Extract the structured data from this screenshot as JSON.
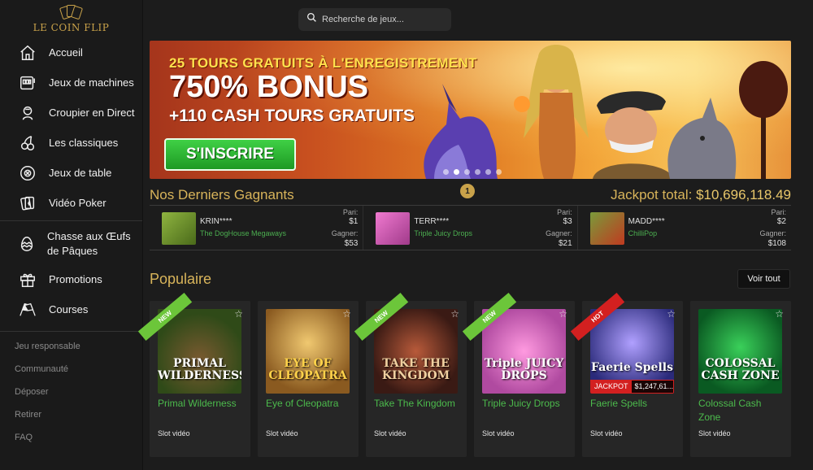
{
  "brand": {
    "name": "LE COIN FLIP"
  },
  "sidebar": {
    "items": [
      {
        "label": "Accueil",
        "icon": "home-icon"
      },
      {
        "label": "Jeux de machines",
        "icon": "slot-machine-icon"
      },
      {
        "label": "Croupier en Direct",
        "icon": "dealer-icon"
      },
      {
        "label": "Les classiques",
        "icon": "cherries-icon"
      },
      {
        "label": "Jeux de table",
        "icon": "chip-icon"
      },
      {
        "label": "Vidéo Poker",
        "icon": "cards-icon"
      },
      {
        "label": "Chasse aux Œufs de Pâques",
        "icon": "egg-icon"
      },
      {
        "label": "Promotions",
        "icon": "gift-icon"
      },
      {
        "label": "Courses",
        "icon": "checkered-flags-icon"
      }
    ],
    "links": [
      "Jeu responsable",
      "Communauté",
      "Déposer",
      "Retirer",
      "FAQ"
    ]
  },
  "search": {
    "placeholder": "Recherche de jeux..."
  },
  "banner": {
    "line1": "25 TOURS GRATUITS À L'ENREGISTREMENT",
    "line2": "750% BONUS",
    "line3": "+110 CASH TOURS GRATUITS",
    "cta": "S'INSCRIRE",
    "dots_count": 6,
    "active_dot": 1
  },
  "winners": {
    "title": "Nos Derniers Gagnants",
    "jackpot_label": "Jackpot total:",
    "jackpot_value": "$10,696,118.49",
    "bet_label": "Pari:",
    "win_label": "Gagner:",
    "entries": [
      {
        "name": "KRIN****",
        "game": "The DogHouse Megaways",
        "bet": "$1",
        "win": "$53",
        "thumb_color": "#6a8a2a"
      },
      {
        "name": "TERR****",
        "game": "Triple Juicy Drops",
        "bet": "$3",
        "win": "$21",
        "thumb_color": "#c84a9a"
      },
      {
        "name": "MADD****",
        "game": "ChilliPop",
        "bet": "$2",
        "win": "$108",
        "thumb_color": "#5a7a30"
      }
    ]
  },
  "popular": {
    "title": "Populaire",
    "see_all": "Voir tout",
    "games": [
      {
        "title": "Primal Wilderness",
        "type": "Slot vidéo",
        "art_label": "PRIMAL WILDERNESS",
        "ribbon": "NEW",
        "bg": "#4a6a28"
      },
      {
        "title": "Eye of Cleopatra",
        "type": "Slot vidéo",
        "art_label": "EYE OF CLEOPATRA",
        "ribbon": "",
        "bg": "#b88a3a"
      },
      {
        "title": "Take The Kingdom",
        "type": "Slot vidéo",
        "art_label": "TAKE THE KINGDOM",
        "ribbon": "NEW",
        "bg": "#6a3a2a"
      },
      {
        "title": "Triple Juicy Drops",
        "type": "Slot vidéo",
        "art_label": "Triple JUICY DROPS",
        "ribbon": "NEW",
        "bg": "#c850a8"
      },
      {
        "title": "Faerie Spells",
        "type": "Slot vidéo",
        "art_label": "Faerie Spells",
        "ribbon": "HOT",
        "bg": "#3a4a9a",
        "jackpot_label": "JACKPOT",
        "jackpot_value": "$1,247,61..."
      },
      {
        "title": "Colossal Cash Zone",
        "type": "Slot vidéo",
        "art_label": "COLOSSAL CASH ZONE",
        "ribbon": "",
        "bg": "#1f8a3a"
      }
    ]
  }
}
